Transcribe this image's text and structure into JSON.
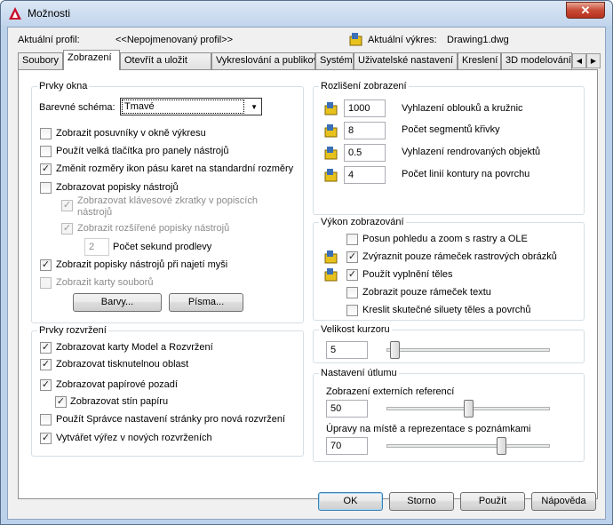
{
  "window": {
    "title": "Možnosti",
    "close_glyph": "✕"
  },
  "profile": {
    "label": "Aktuální profil:",
    "value": "<<Nepojmenovaný profil>>",
    "drawing_label": "Aktuální výkres:",
    "drawing_value": "Drawing1.dwg"
  },
  "tabs": [
    "Soubory",
    "Zobrazení",
    "Otevřít a uložit",
    "Vykreslování a publikování",
    "Systém",
    "Uživatelské nastavení",
    "Kreslení",
    "3D modelování"
  ],
  "active_tab": "Zobrazení",
  "tab_scroll": {
    "left": "◀",
    "right": "▶"
  },
  "window_elements": {
    "title": "Prvky okna",
    "color_scheme_label": "Barevné schéma:",
    "color_scheme_value": "Tmavé",
    "checkboxes": [
      {
        "label": "Zobrazit posuvníky v okně výkresu",
        "checked": false
      },
      {
        "label": "Použít velká tlačítka pro panely nástrojů",
        "checked": false
      },
      {
        "label": "Změnit rozměry ikon pásu karet na standardní rozměry",
        "checked": true
      },
      {
        "label": "Zobrazovat popisky nástrojů",
        "checked": false
      },
      {
        "label": "Zobrazovat klávesové zkratky v popiscích",
        "label2": "nástrojů",
        "checked": true,
        "disabled": true
      },
      {
        "label": "Zobrazit rozšířené popisky nástrojů",
        "checked": true,
        "disabled": true
      },
      {
        "label": "Zobrazit popisky nástrojů při najetí myši",
        "checked": true
      },
      {
        "label": "Zobrazit karty souborů",
        "checked": false,
        "disabled": true
      }
    ],
    "delay_value": "2",
    "delay_label": "Počet sekund prodlevy",
    "colors_button": "Barvy...",
    "fonts_button": "Písma..."
  },
  "layout_elements": {
    "title": "Prvky rozvržení",
    "checkboxes": [
      {
        "label": "Zobrazovat karty Model a Rozvržení",
        "checked": true
      },
      {
        "label": "Zobrazovat tisknutelnou oblast",
        "checked": true
      },
      {
        "label": "Zobrazovat papírové pozadí",
        "checked": true
      },
      {
        "label": "Zobrazovat stín papíru",
        "checked": true
      },
      {
        "label": "Použít Správce nastavení stránky pro nová rozvržení",
        "checked": false
      },
      {
        "label": "Vytvářet výřez v nových rozvrženích",
        "checked": true
      }
    ]
  },
  "display_resolution": {
    "title": "Rozlišení zobrazení",
    "rows": [
      {
        "value": "1000",
        "label": "Vyhlazení oblouků a kružnic"
      },
      {
        "value": "8",
        "label": "Počet segmentů křivky"
      },
      {
        "value": "0.5",
        "label": "Vyhlazení rendrovaných objektů"
      },
      {
        "value": "4",
        "label": "Počet linií kontury na povrchu"
      }
    ]
  },
  "display_performance": {
    "title": "Výkon zobrazování",
    "checkboxes": [
      {
        "label": "Posun pohledu a zoom s rastry a OLE",
        "checked": false
      },
      {
        "label": "Zvýraznit pouze rámeček rastrových obrázků",
        "checked": true
      },
      {
        "label": "Použít vyplnění těles",
        "checked": true
      },
      {
        "label": "Zobrazit pouze rámeček textu",
        "checked": false
      },
      {
        "label": "Kreslit skutečné siluety těles a povrchů",
        "checked": false
      }
    ]
  },
  "crosshair": {
    "title": "Velikost kurzoru",
    "value": "5",
    "slider_fraction": 0.05
  },
  "fade": {
    "title": "Nastavení útlumu",
    "xref_label": "Zobrazení externích referencí",
    "xref_value": "50",
    "xref_fraction": 0.5,
    "inplace_label": "Úpravy na místě a reprezentace s poznámkami",
    "inplace_value": "70",
    "inplace_fraction": 0.7
  },
  "footer": {
    "ok": "OK",
    "cancel": "Storno",
    "apply": "Použít",
    "help": "Nápověda"
  }
}
